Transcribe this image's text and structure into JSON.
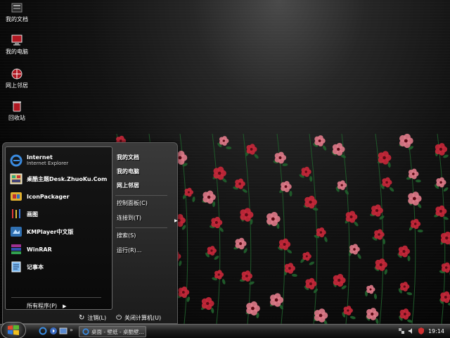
{
  "desktop": {
    "icons": [
      {
        "label": "我的文档",
        "icon": "my-documents-icon"
      },
      {
        "label": "我的电脑",
        "icon": "my-computer-icon"
      },
      {
        "label": "网上邻居",
        "icon": "network-places-icon"
      },
      {
        "label": "回收站",
        "icon": "recycle-bin-icon"
      }
    ]
  },
  "start_menu": {
    "pinned": [
      {
        "name": "Internet",
        "sub": "Internet Explorer",
        "icon": "internet-explorer-icon"
      },
      {
        "name": "桌酷主题Desk.ZhuoKu.Com",
        "icon": "zhuoku-theme-icon"
      },
      {
        "name": "IconPackager",
        "icon": "iconpackager-icon"
      },
      {
        "name": "画图",
        "icon": "paint-icon"
      },
      {
        "name": "KMPlayer中文版",
        "icon": "kmplayer-icon"
      },
      {
        "name": "WinRAR",
        "icon": "winrar-icon"
      },
      {
        "name": "记事本",
        "icon": "notepad-icon"
      }
    ],
    "all_programs": "所有程序(P)",
    "right": {
      "my_documents": "我的文档",
      "my_computer": "我的电脑",
      "network_places": "网上邻居",
      "control_panel": "控制面板(C)",
      "connect_to": "连接到(T)",
      "search": "搜索(S)",
      "run": "运行(R)..."
    },
    "logoff": "注销(L)",
    "shutdown": "关闭计算机(U)"
  },
  "taskbar": {
    "quick_launch_more": "»",
    "tasks": [
      {
        "label": "桌面 - 壁纸 - 桌酷壁..."
      }
    ],
    "clock": "19:14"
  },
  "colors": {
    "flower": "#c8283a",
    "flower_light": "#e07a8a",
    "leaf": "#1f5a2a",
    "menu_border": "#6a6a6a"
  }
}
